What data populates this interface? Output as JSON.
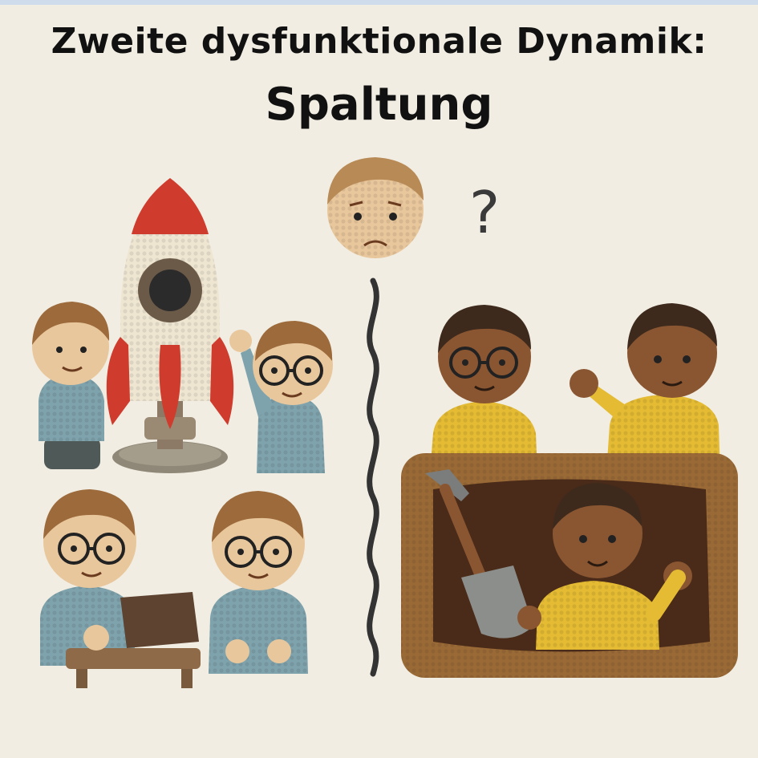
{
  "title": {
    "line1": "Zweite dysfunktionale Dynamik:",
    "line2": "Spaltung"
  },
  "question_mark": "?",
  "colors": {
    "background": "#f1ede2",
    "rocket_red": "#cf3b2c",
    "shirt_blue": "#7fa3ad",
    "shirt_yellow": "#e4bb33",
    "soil_brown": "#8a5a2b",
    "skin_light": "#e9c79c",
    "skin_dark": "#8a5632"
  }
}
